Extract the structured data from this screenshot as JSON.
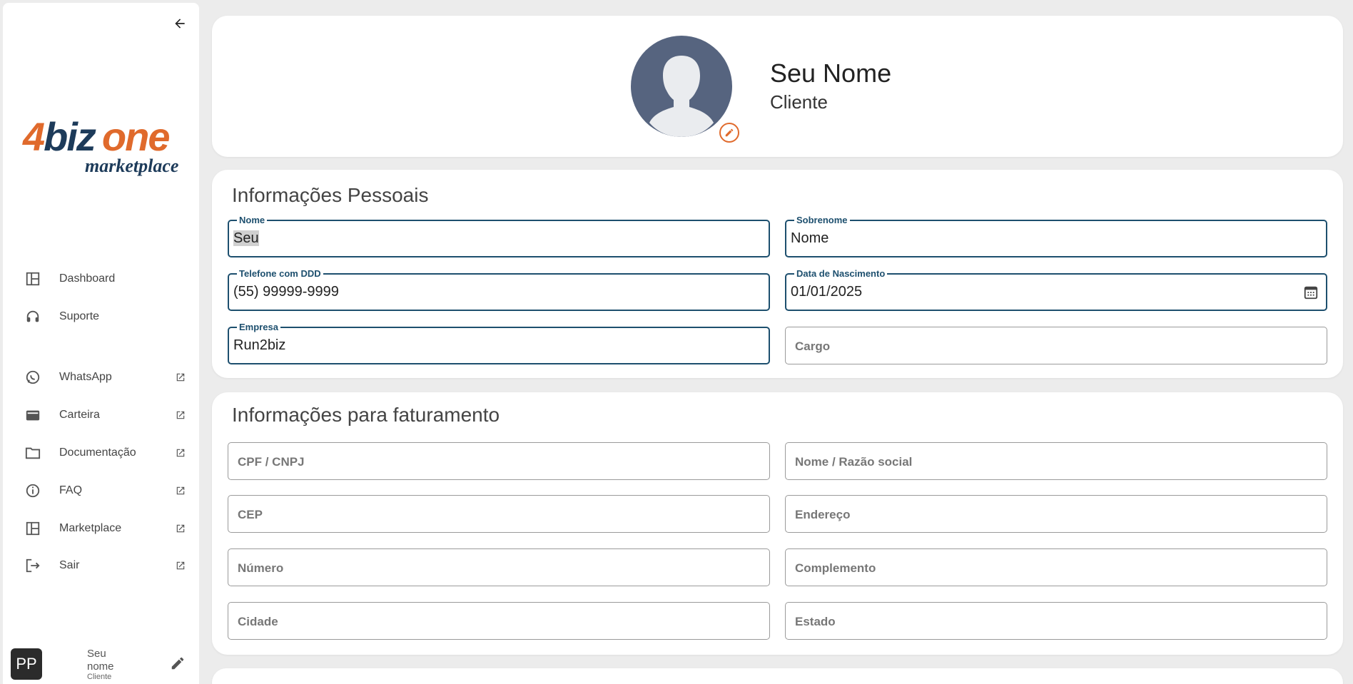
{
  "sidebar": {
    "logo": {
      "top_4": "4",
      "top_biz": "biz",
      "top_one": "one",
      "bottom": "marketplace"
    },
    "colors": {
      "brand_orange": "#e06a2c",
      "brand_navy": "#1d3b5a"
    },
    "nav": [
      {
        "label": "Dashboard",
        "icon": "dashboard-icon",
        "external": false
      },
      {
        "label": "Suporte",
        "icon": "headset-icon",
        "external": false
      },
      {
        "label": "WhatsApp",
        "icon": "whatsapp-icon",
        "external": true
      },
      {
        "label": "Carteira",
        "icon": "wallet-icon",
        "external": true
      },
      {
        "label": "Documentação",
        "icon": "folder-icon",
        "external": true
      },
      {
        "label": "FAQ",
        "icon": "info-icon",
        "external": true
      },
      {
        "label": "Marketplace",
        "icon": "dashboard-icon",
        "external": true
      },
      {
        "label": "Sair",
        "icon": "logout-icon",
        "external": true
      }
    ],
    "user": {
      "initials": "PP",
      "name": "Seu nome",
      "role": "Cliente"
    }
  },
  "profile": {
    "name": "Seu Nome",
    "role": "Cliente"
  },
  "personal": {
    "title": "Informações Pessoais",
    "nome": {
      "label": "Nome",
      "value": "Seu"
    },
    "sobrenome": {
      "label": "Sobrenome",
      "value": "Nome"
    },
    "telefone": {
      "label": "Telefone com DDD",
      "value": "(55) 99999-9999"
    },
    "nascimento": {
      "label": "Data de Nascimento",
      "value": "01/01/2025"
    },
    "empresa": {
      "label": "Empresa",
      "value": "Run2biz"
    },
    "cargo": {
      "placeholder": "Cargo"
    }
  },
  "billing": {
    "title": "Informações para faturamento",
    "cpf": "CPF / CNPJ",
    "razao": "Nome / Razão social",
    "cep": "CEP",
    "endereco": "Endereço",
    "numero": "Número",
    "complemento": "Complemento",
    "cidade": "Cidade",
    "estado": "Estado"
  }
}
